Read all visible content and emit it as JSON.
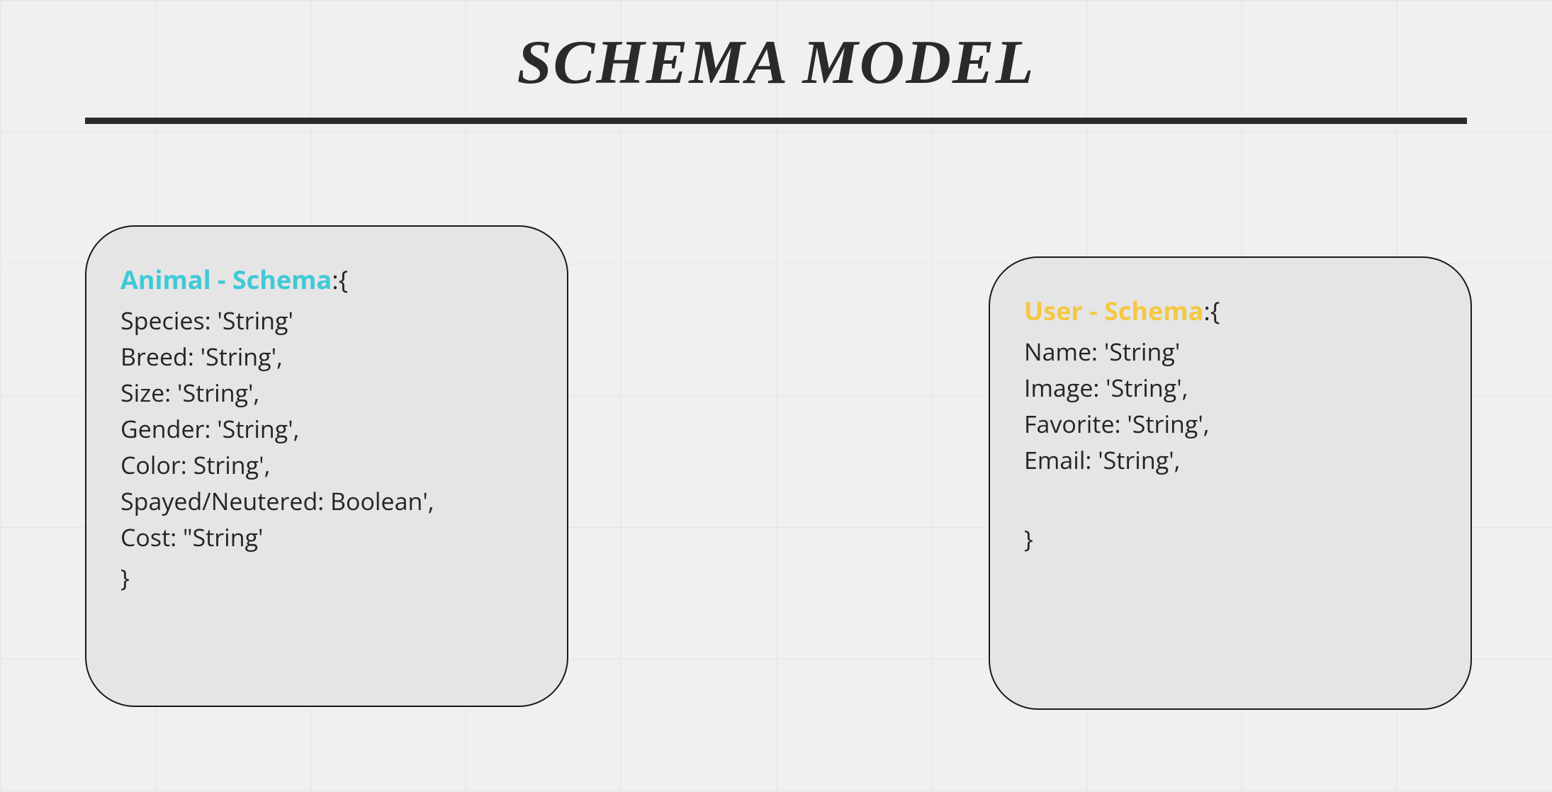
{
  "title": "Schema Model",
  "schemas": {
    "animal": {
      "title": "Animal - Schema",
      "titleSuffix": ":{",
      "fields": [
        "Species: 'String'",
        "Breed: 'String',",
        "Size: 'String',",
        "Gender: 'String',",
        "Color: String',",
        "Spayed/Neutered: Boolean',",
        "Cost: \"String'"
      ],
      "close": "}"
    },
    "user": {
      "title": "User - Schema",
      "titleSuffix": ":{",
      "fields": [
        "Name: 'String'",
        "Image: 'String',",
        "Favorite: 'String',",
        "Email: 'String',"
      ],
      "close": "}"
    }
  }
}
